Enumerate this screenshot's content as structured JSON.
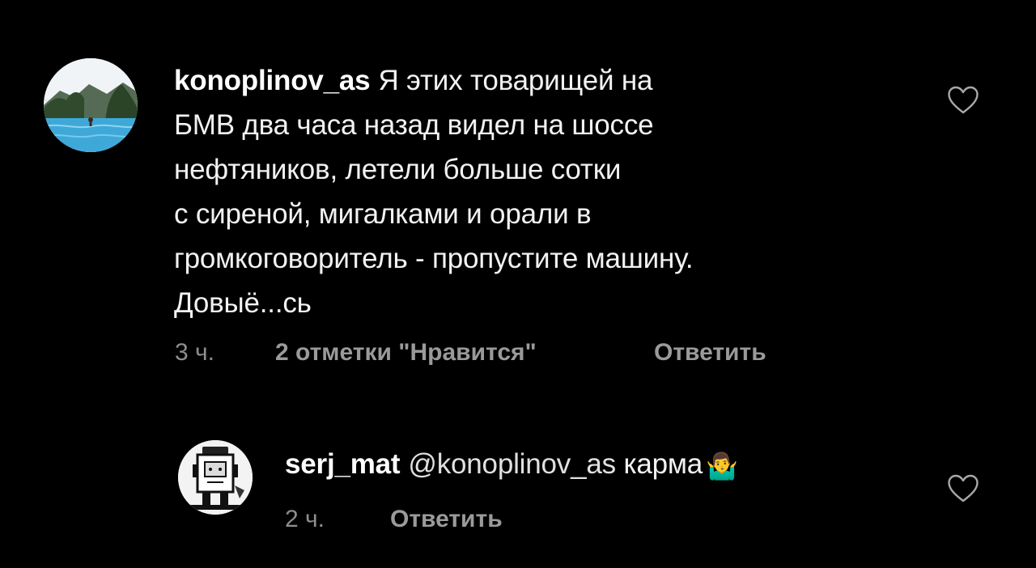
{
  "comments": [
    {
      "username": "konoplinov_as",
      "text_lines": [
        "Я этих товарищей на",
        "БМВ два часа назад видел на шоссе",
        "нефтяников, летели больше сотки",
        "с сиреной, мигалками и орали в",
        "громкоговоритель - пропустите машину.",
        "Довыё...сь"
      ],
      "time": "3 ч.",
      "likes": "2 отметки \"Нравится\"",
      "reply_label": "Ответить",
      "avatar_icon": "avatar-pool-photo",
      "like_icon": "heart-outline-icon"
    },
    {
      "username": "serj_mat",
      "mention": "@konoplinov_as",
      "text": "карма",
      "emoji": "🤷‍♂️",
      "time": "2 ч.",
      "reply_label": "Ответить",
      "avatar_icon": "avatar-robot-drawing",
      "like_icon": "heart-outline-icon"
    }
  ],
  "colors": {
    "background": "#000000",
    "text": "#f2f2f2",
    "meta": "#8e8e8e",
    "heart_stroke": "#a8a8a8"
  }
}
